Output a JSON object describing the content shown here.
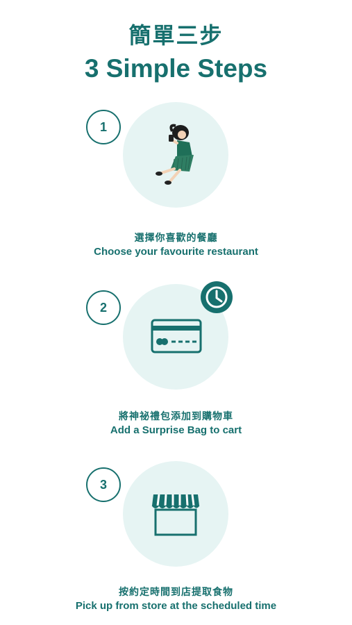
{
  "header": {
    "title_zh": "簡單三步",
    "title_en": "3 Simple Steps"
  },
  "steps": [
    {
      "number": "1",
      "label_zh": "選擇你喜歡的餐廳",
      "label_en": "Choose your favourite restaurant",
      "illustration": "girl-with-phone-illustration"
    },
    {
      "number": "2",
      "label_zh": "將神祕禮包添加到購物車",
      "label_en": "Add a Surprise Bag to cart",
      "illustration": "credit-card-icon",
      "badge": "clock-icon"
    },
    {
      "number": "3",
      "label_zh": "按約定時間到店提取食物",
      "label_en": "Pick up from store at the scheduled time",
      "illustration": "storefront-icon"
    }
  ],
  "colors": {
    "primary": "#17706e",
    "circle_bg": "#e6f4f3",
    "background": "#ffffff"
  }
}
